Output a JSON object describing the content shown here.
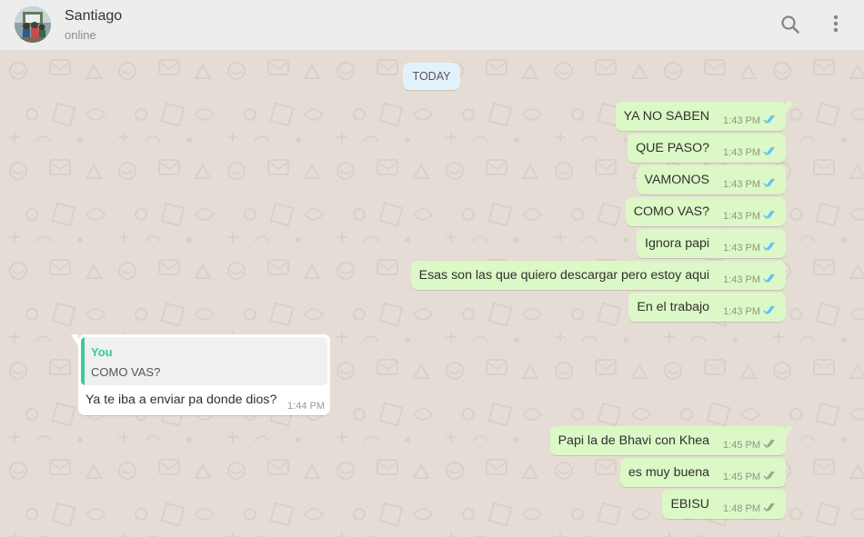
{
  "header": {
    "contact_name": "Santiago",
    "contact_status": "online",
    "icons": [
      "search-icon",
      "menu-icon"
    ]
  },
  "chat": {
    "date_separator": "TODAY",
    "messages_group_1": [
      {
        "text": "YA NO SABEN",
        "time": "1:43 PM",
        "status": "read"
      },
      {
        "text": "QUE PASO?",
        "time": "1:43 PM",
        "status": "read"
      },
      {
        "text": "VAMONOS",
        "time": "1:43 PM",
        "status": "read"
      },
      {
        "text": "COMO VAS?",
        "time": "1:43 PM",
        "status": "read"
      },
      {
        "text": "Ignora papi",
        "time": "1:43 PM",
        "status": "read"
      },
      {
        "text": "Esas son las que quiero descargar pero estoy aqui",
        "time": "1:43 PM",
        "status": "read"
      },
      {
        "text": "En el trabajo",
        "time": "1:43 PM",
        "status": "read"
      }
    ],
    "incoming": {
      "quote_author": "You",
      "quote_text": "COMO VAS?",
      "text": "Ya te iba a enviar pa donde dios?",
      "time": "1:44 PM"
    },
    "messages_group_2": [
      {
        "text": "Papi la de Bhavi con Khea",
        "time": "1:45 PM",
        "status": "delivered"
      },
      {
        "text": "es muy buena",
        "time": "1:45 PM",
        "status": "delivered"
      },
      {
        "text": "EBISU",
        "time": "1:48 PM",
        "status": "delivered"
      }
    ]
  },
  "colors": {
    "chat_background": "#e5ddd5",
    "outgoing_bubble": "#dcf8c6",
    "incoming_bubble": "#ffffff",
    "read_ticks": "#4fc3f7",
    "delivered_ticks": "#92a58c",
    "quote_accent": "#35cd96",
    "date_pill": "#e1f2fb"
  }
}
